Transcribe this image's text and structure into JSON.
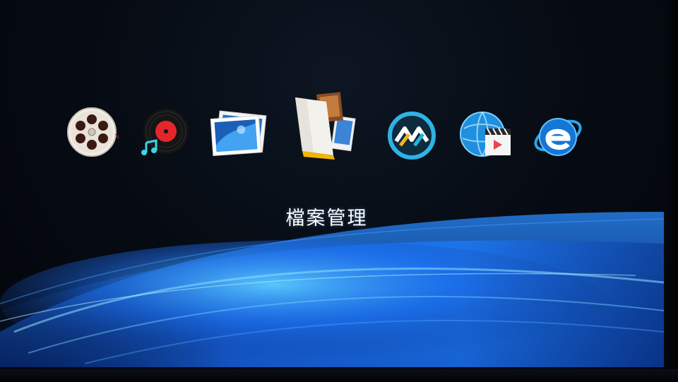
{
  "launcher": {
    "selected_label": "檔案管理",
    "apps": [
      {
        "icon": "film-reel-icon",
        "selected": false
      },
      {
        "icon": "music-record-icon",
        "selected": false
      },
      {
        "icon": "photo-gallery-icon",
        "selected": false
      },
      {
        "icon": "file-manager-icon",
        "selected": true
      },
      {
        "icon": "online-app-icon",
        "selected": false
      },
      {
        "icon": "web-video-icon",
        "selected": false
      },
      {
        "icon": "internet-explorer-icon",
        "selected": false
      }
    ]
  },
  "colors": {
    "background": "#04070c",
    "wave_blue": "#1f7fff",
    "label_text": "#ffffff"
  }
}
